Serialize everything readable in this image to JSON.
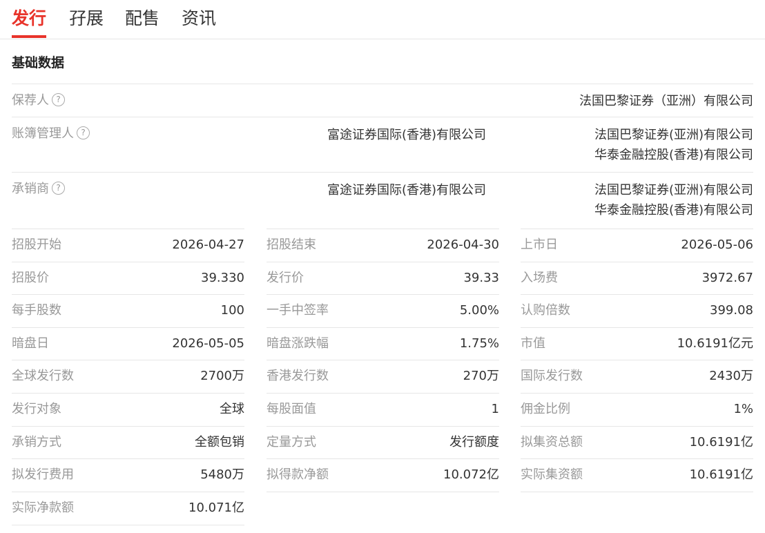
{
  "tabs": [
    {
      "label": "发行",
      "active": true
    },
    {
      "label": "孖展",
      "active": false
    },
    {
      "label": "配售",
      "active": false
    },
    {
      "label": "资讯",
      "active": false
    }
  ],
  "section_title": "基础数据",
  "help_glyph": "?",
  "sponsor": {
    "label": "保荐人",
    "right": "法国巴黎证券（亚洲）有限公司"
  },
  "bookrunner": {
    "label": "账簿管理人",
    "mid": "富途证券国际(香港)有限公司",
    "right": [
      "法国巴黎证券(亚洲)有限公司",
      "华泰金融控股(香港)有限公司"
    ]
  },
  "underwriter": {
    "label": "承销商",
    "mid": "富途证券国际(香港)有限公司",
    "right": [
      "法国巴黎证券(亚洲)有限公司",
      "华泰金融控股(香港)有限公司"
    ]
  },
  "grid": [
    [
      {
        "label": "招股开始",
        "value": "2026-04-27"
      },
      {
        "label": "招股结束",
        "value": "2026-04-30"
      },
      {
        "label": "上市日",
        "value": "2026-05-06"
      }
    ],
    [
      {
        "label": "招股价",
        "value": "39.330"
      },
      {
        "label": "发行价",
        "value": "39.33"
      },
      {
        "label": "入场费",
        "value": "3972.67"
      }
    ],
    [
      {
        "label": "每手股数",
        "value": "100"
      },
      {
        "label": "一手中签率",
        "value": "5.00%"
      },
      {
        "label": "认购倍数",
        "value": "399.08"
      }
    ],
    [
      {
        "label": "暗盘日",
        "value": "2026-05-05"
      },
      {
        "label": "暗盘涨跌幅",
        "value": "1.75%"
      },
      {
        "label": "市值",
        "value": "10.6191亿元"
      }
    ],
    [
      {
        "label": "全球发行数",
        "value": "2700万"
      },
      {
        "label": "香港发行数",
        "value": "270万"
      },
      {
        "label": "国际发行数",
        "value": "2430万"
      }
    ],
    [
      {
        "label": "发行对象",
        "value": "全球"
      },
      {
        "label": "每股面值",
        "value": "1"
      },
      {
        "label": "佣金比例",
        "value": "1%"
      }
    ],
    [
      {
        "label": "承销方式",
        "value": "全额包销"
      },
      {
        "label": "定量方式",
        "value": "发行额度"
      },
      {
        "label": "拟集资总额",
        "value": "10.6191亿"
      }
    ],
    [
      {
        "label": "拟发行费用",
        "value": "5480万"
      },
      {
        "label": "拟得款净额",
        "value": "10.072亿"
      },
      {
        "label": "实际集资额",
        "value": "10.6191亿"
      }
    ],
    [
      {
        "label": "实际净款额",
        "value": "10.071亿"
      }
    ]
  ]
}
